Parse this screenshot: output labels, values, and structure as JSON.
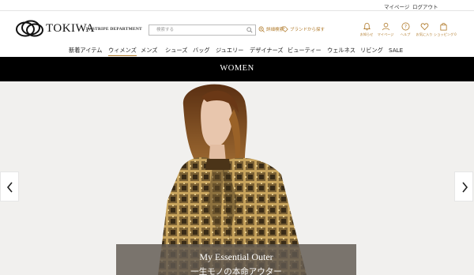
{
  "utility": {
    "mypage": "マイページ",
    "logout": "ログアウト"
  },
  "logo": {
    "name": "TOKIWA",
    "by": "by",
    "store": "STRIPE DEPARTMENT"
  },
  "search": {
    "placeholder": "検索する"
  },
  "header_links": {
    "detail_search": "詳細検索",
    "brand_search": "ブランドから探す"
  },
  "header_icons": [
    {
      "icon": "bell-icon",
      "label": "お知らせ"
    },
    {
      "icon": "user-icon",
      "label": "マイページ"
    },
    {
      "icon": "help-icon",
      "label": "ヘルプ"
    },
    {
      "icon": "heart-icon",
      "label": "お気に入り"
    },
    {
      "icon": "bag-icon",
      "label": "ショッピング",
      "badge": "0"
    }
  ],
  "categories": [
    "新着アイテム",
    "ウィメンズ",
    "メンズ",
    "シューズ",
    "バッグ",
    "ジュエリー",
    "デザイナーズ",
    "ビューティー",
    "ウェルネス",
    "リビング",
    "SALE"
  ],
  "active_category": "ウィメンズ",
  "section": {
    "title": "WOMEN"
  },
  "hero": {
    "caption_en": "My Essential Outer",
    "caption_jp": "一生モノの本命アウター"
  },
  "colors": {
    "accent": "#b07a2a",
    "banner_bg": "#000000",
    "hero_bg": "#f1f0ee"
  }
}
